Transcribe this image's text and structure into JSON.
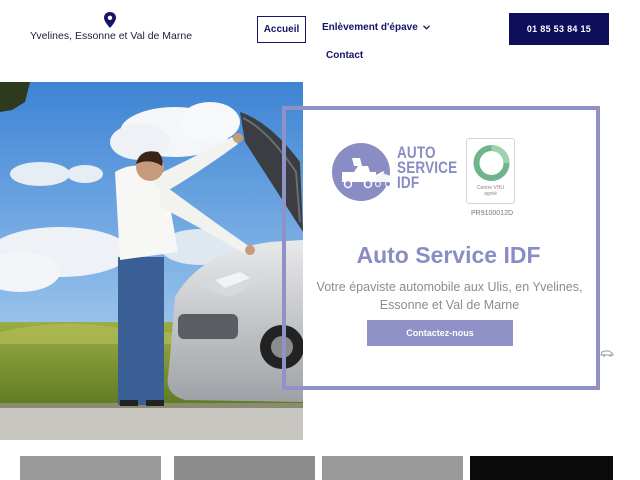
{
  "header": {
    "location_text": "Yvelines, Essonne et Val de Marne",
    "location_icon": "map-pin-icon",
    "nav": {
      "home": "Accueil",
      "enlevement": "Enlèvement d'épave",
      "contact": "Contact"
    },
    "phone": "01 85 53 84 15"
  },
  "hero": {
    "logo_line1": "AUTO",
    "logo_line2": "SERVICE",
    "logo_line3": "IDF",
    "vhu_label_line1": "Centre VHU",
    "vhu_label_line2": "agréé",
    "vhu_code": "PR9100012D",
    "title": "Auto Service IDF",
    "subtitle": "Votre épaviste automobile aux Ulis, en Yvelines, Essonne et Val de Marne",
    "cta": "Contactez-nous"
  },
  "colors": {
    "navy": "#161466",
    "accent": "#8f91c7",
    "phone_bg": "#0f0e5a"
  }
}
